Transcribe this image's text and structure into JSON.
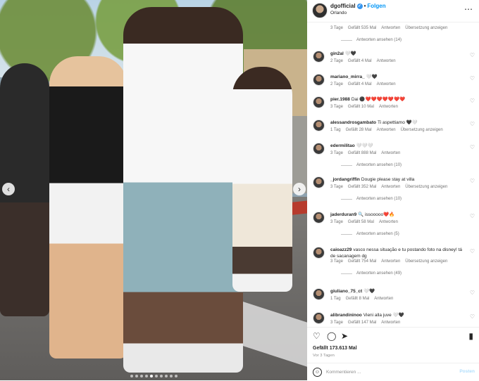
{
  "header": {
    "username": "dgofficial",
    "follow_label": "Folgen",
    "location": "Orlando"
  },
  "photo": {
    "page_count": 10,
    "active_index": 4
  },
  "comments": [
    {
      "meta": [
        "3 Tage",
        "Gefällt 535 Mal",
        "Antworten",
        "Übersetzung anzeigen"
      ],
      "replies": "Antworten ansehen (14)"
    },
    {
      "username": "gin2al",
      "text": "🤍🖤",
      "meta": [
        "2 Tage",
        "Gefällt 4 Mal",
        "Antworten"
      ]
    },
    {
      "username": "mariano_mirra_",
      "text": "🤍🖤",
      "meta": [
        "2 Tage",
        "Gefällt 4 Mal",
        "Antworten"
      ]
    },
    {
      "username": "pier.1988",
      "text": "Dai ⚫❤️❤️❤️❤️❤️❤️❤️",
      "meta": [
        "3 Tage",
        "Gefällt 10 Mal",
        "Antworten"
      ]
    },
    {
      "username": "alessandrosgambato",
      "text": "Ti aspettiamo 🖤🤍",
      "meta": [
        "1 Tag",
        "Gefällt 28 Mal",
        "Antworten",
        "Übersetzung anzeigen"
      ]
    },
    {
      "username": "edermilitao",
      "text": "🤍🤍🤍",
      "meta": [
        "3 Tage",
        "Gefällt 888 Mal",
        "Antworten"
      ],
      "replies": "Antworten ansehen (10)"
    },
    {
      "username": "_jordangriffin",
      "text": "Dougie please stay at villa",
      "meta": [
        "3 Tage",
        "Gefällt 352 Mal",
        "Antworten",
        "Übersetzung anzeigen"
      ],
      "replies": "Antworten ansehen (10)"
    },
    {
      "username": "jaderduran9",
      "text": "🔍 issooooo❤️🔥",
      "meta": [
        "3 Tage",
        "Gefällt 58 Mal",
        "Antworten"
      ],
      "replies": "Antworten ansehen (5)"
    },
    {
      "username": "caioazz29",
      "text": "vasco nessa situação e tu postando foto na disney! tá de sacanagem dg",
      "meta": [
        "3 Tage",
        "Gefällt 754 Mal",
        "Antworten",
        "Übersetzung anzeigen"
      ],
      "replies": "Antworten ansehen (49)"
    },
    {
      "username": "giuliano_75_ct",
      "text": "🤍🖤",
      "meta": [
        "1 Tag",
        "Gefällt 8 Mal",
        "Antworten"
      ]
    },
    {
      "username": "alibrandininoo",
      "text": "Vieni alla juve 🤍🖤",
      "meta": [
        "3 Tage",
        "Gefällt 147 Mal",
        "Antworten"
      ]
    }
  ],
  "footer": {
    "likes": "Gefällt 173.613 Mal",
    "date": "Vor 3 Tagen",
    "comment_placeholder": "Kommentieren ...",
    "post_label": "Posten"
  },
  "colors": {
    "accent": "#0095f6",
    "verified": "#3897f0",
    "meta_text": "#737373"
  }
}
